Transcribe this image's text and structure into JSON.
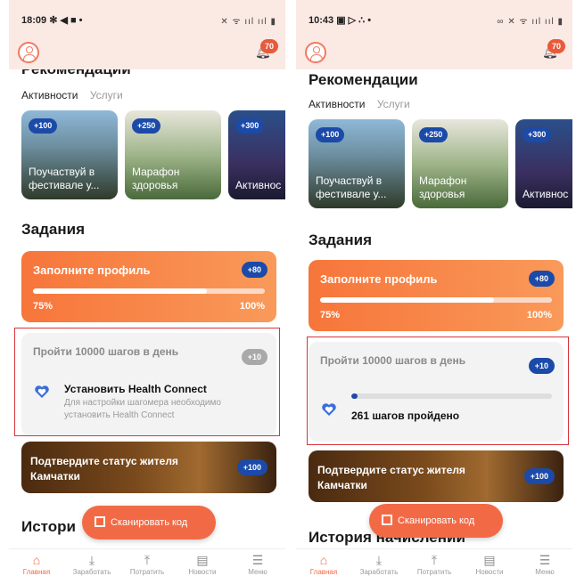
{
  "left": {
    "status": {
      "time": "18:09 ✻ ◀ ■ •",
      "icons": "✕ ᯤ ııl ııl ▮"
    },
    "notifications_count": "70",
    "recommendations_title": "Рекомендации",
    "tabs": [
      "Активности",
      "Услуги"
    ],
    "promos": [
      {
        "points": "+100",
        "label": "Поучаствуй в фестивале у..."
      },
      {
        "points": "+250",
        "label": "Марафон здоровья"
      },
      {
        "points": "+300",
        "label": "Активнос"
      }
    ],
    "tasks_title": "Задания",
    "profile_task": {
      "title": "Заполните профиль",
      "points": "+80",
      "progress_label": "75%",
      "target_label": "100%",
      "progress": 0.75
    },
    "steps_task": {
      "title": "Пройти 10000 шагов в день",
      "points": "+10",
      "action_title": "Установить Health Connect",
      "action_subtitle": "Для настройки шагомера необходимо установить Health Connect"
    },
    "resident_task": {
      "title": "Подтвердите статус жителя Камчатки",
      "points": "+100"
    },
    "history_title": "Истори",
    "scan_label": "Сканировать код"
  },
  "right": {
    "status": {
      "time": "10:43 ▣ ▷ ∴ •",
      "icons": "∞ ✕ ᯤ ııl ııl ▮"
    },
    "notifications_count": "70",
    "recommendations_title": "Рекомендации",
    "tabs": [
      "Активности",
      "Услуги"
    ],
    "promos": [
      {
        "points": "+100",
        "label": "Поучаствуй в фестивале у..."
      },
      {
        "points": "+250",
        "label": "Марафон здоровья"
      },
      {
        "points": "+300",
        "label": "Активнос"
      }
    ],
    "tasks_title": "Задания",
    "profile_task": {
      "title": "Заполните профиль",
      "points": "+80",
      "progress_label": "75%",
      "target_label": "100%",
      "progress": 0.75
    },
    "steps_task": {
      "title": "Пройти 10000 шагов в день",
      "points": "+10",
      "steps_text": "261 шагов пройдено",
      "progress": 0.03
    },
    "resident_task": {
      "title": "Подтвердите статус жителя Камчатки",
      "points": "+100"
    },
    "history_title": "История начислений",
    "scan_label": "Сканировать код"
  },
  "nav": [
    "Главная",
    "Заработать",
    "Потратить",
    "Новости",
    "Меню"
  ],
  "nav_icons": [
    "home-icon",
    "download-icon",
    "upload-icon",
    "news-icon",
    "menu-icon"
  ],
  "colors": {
    "accent": "#f26a45",
    "badge_blue": "#1b4aa8",
    "highlight": "#d8343b"
  }
}
